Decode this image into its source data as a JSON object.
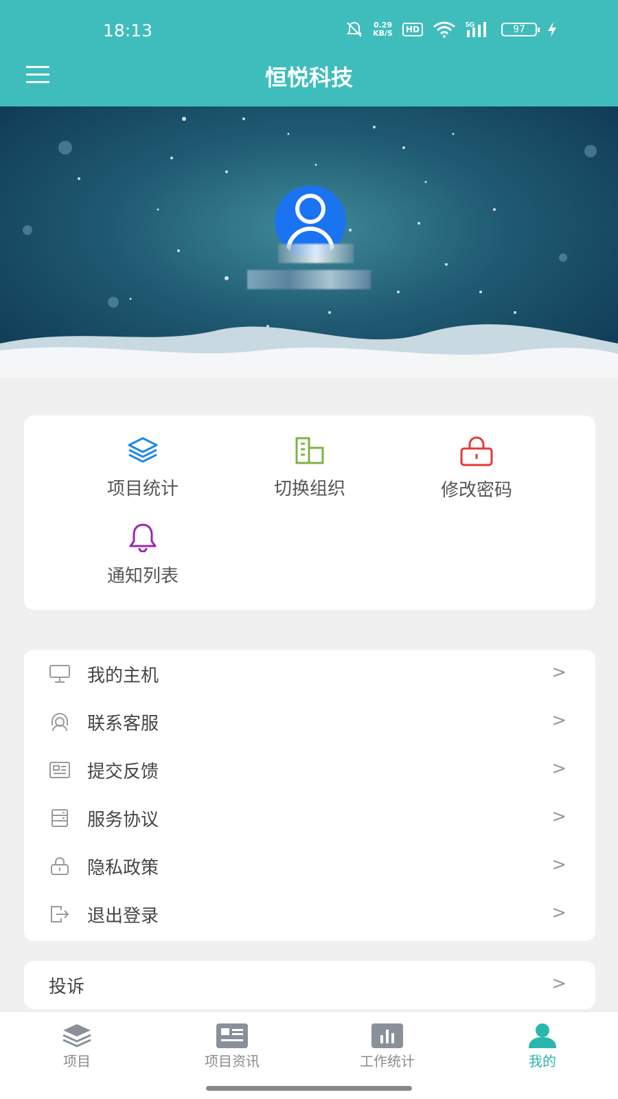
{
  "status_bar": {
    "time": "18:13",
    "speed_value": "0.29",
    "speed_unit": "KB/S",
    "hd": "HD",
    "network": "5G",
    "battery": "97"
  },
  "header": {
    "title": "恒悦科技",
    "color": "#3fbdbd"
  },
  "quick_actions": [
    {
      "label": "项目统计",
      "icon": "layers-icon",
      "color": "#1e88e5"
    },
    {
      "label": "切换组织",
      "icon": "building-icon",
      "color": "#7cb342"
    },
    {
      "label": "修改密码",
      "icon": "lock-icon",
      "color": "#e53935"
    },
    {
      "label": "通知列表",
      "icon": "bell-icon",
      "color": "#9c27b0"
    }
  ],
  "menu_list": [
    {
      "label": "我的主机",
      "icon": "monitor-icon"
    },
    {
      "label": "联系客服",
      "icon": "headset-icon"
    },
    {
      "label": "提交反馈",
      "icon": "id-card-icon"
    },
    {
      "label": "服务协议",
      "icon": "document-icon"
    },
    {
      "label": "隐私政策",
      "icon": "lock-icon"
    },
    {
      "label": "退出登录",
      "icon": "logout-icon"
    }
  ],
  "complaint": {
    "label": "投诉"
  },
  "chevron": ">",
  "tabbar": [
    {
      "label": "项目",
      "icon": "layers-icon",
      "active": false
    },
    {
      "label": "项目资讯",
      "icon": "news-icon",
      "active": false
    },
    {
      "label": "工作统计",
      "icon": "bar-chart-icon",
      "active": false
    },
    {
      "label": "我的",
      "icon": "user-icon",
      "active": true
    }
  ],
  "accent_color": "#29b6ad"
}
